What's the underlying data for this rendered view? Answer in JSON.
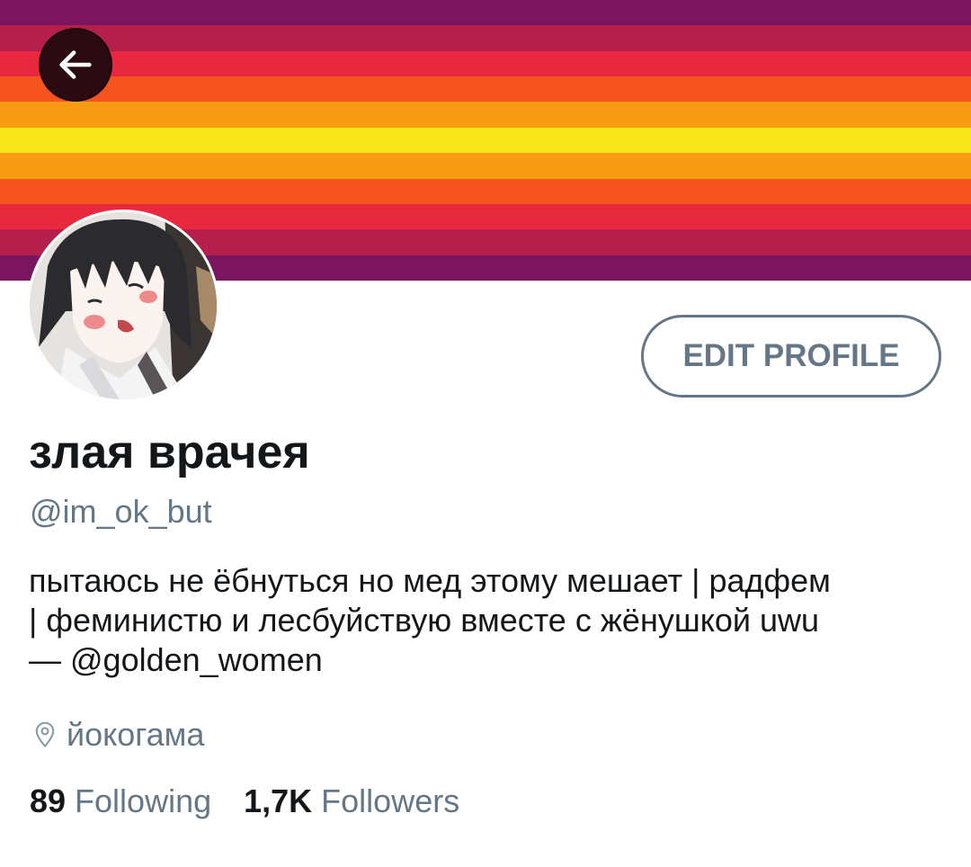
{
  "profile": {
    "display_name": "злая врачея",
    "handle": "@im_ok_but",
    "bio_lines": [
      "пытаюсь не ёбнуться но мед этому мешает | радфем",
      "| феминистю и лесбуйствую вместе с жёнушкой uwu",
      "— "
    ],
    "bio_mention": "@golden_women",
    "location": "йокогама",
    "following_count": "89",
    "following_label": "Following",
    "followers_count": "1,7K",
    "followers_label": "Followers"
  },
  "actions": {
    "edit_profile_label": "EDIT PROFILE"
  },
  "icons": {
    "back": "arrow-left-icon",
    "location": "location-pin-icon"
  },
  "colors": {
    "banner_stripes": [
      "#8a1a5c",
      "#b8204a",
      "#e82a3c",
      "#f55a22",
      "#f8a616",
      "#f9e31c",
      "#f8a616",
      "#f55a22",
      "#e82a3c",
      "#b8204a",
      "#8a1a5c"
    ],
    "text_primary": "#14171a",
    "text_secondary": "#657786",
    "back_button_bg": "#2b0a12"
  }
}
